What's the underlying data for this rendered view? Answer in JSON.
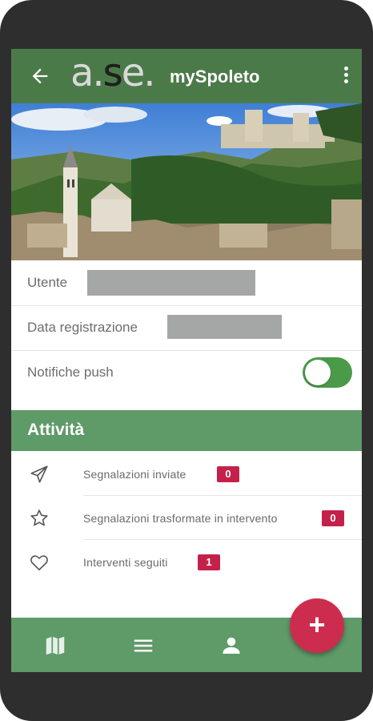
{
  "app": {
    "logo_text": "a.se.",
    "title": "mySpoleto",
    "back_icon": "arrow-left-icon",
    "menu_icon": "more-vertical-icon"
  },
  "profile": {
    "user_label": "Utente",
    "registration_label": "Data registrazione",
    "push_label": "Notifiche push",
    "push_enabled": true
  },
  "activity": {
    "title": "Attività",
    "items": [
      {
        "icon": "send-icon",
        "label": "Segnalazioni inviate",
        "count": "0"
      },
      {
        "icon": "star-icon",
        "label": "Segnalazioni trasformate in intervento",
        "count": "0"
      },
      {
        "icon": "heart-icon",
        "label": "Interventi seguiti",
        "count": "1"
      }
    ]
  },
  "bottom_nav": {
    "items": [
      {
        "icon": "map-icon"
      },
      {
        "icon": "list-icon"
      },
      {
        "icon": "person-icon"
      }
    ],
    "fab_label": "+"
  },
  "colors": {
    "appbar": "#4b7a49",
    "section": "#5f9a69",
    "badge": "#c4214a",
    "fab": "#cc2d4f"
  }
}
